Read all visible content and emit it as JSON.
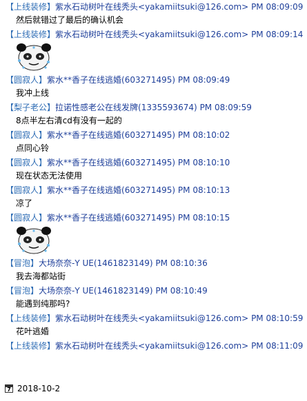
{
  "messages": [
    {
      "title": "【上线装修】",
      "sender": "紫水石动树叶在线秃头<yakamiitsuki@126.com>",
      "time": "PM 08:09:09"
    },
    {
      "text": "然后就错过了最后的确认机会"
    },
    {
      "title": "【上线装修】",
      "sender": "紫水石动树叶在线秃头<yakamiitsuki@126.com>",
      "time": "PM 08:09:14"
    },
    {
      "sticker": "panda-face-sticker"
    },
    {
      "title": "【圆寂人】",
      "sender": "紫水**香子在线逃婚(603271495)",
      "time": "PM 08:09:49"
    },
    {
      "text": "我冲上线"
    },
    {
      "title": "【梨子老公】",
      "sender": "拉诺性感老公在线发牌(1335593674)",
      "time": "PM 08:09:59"
    },
    {
      "text": "8点半左右清cd有没有一起的"
    },
    {
      "title": "【圆寂人】",
      "sender": "紫水**香子在线逃婚(603271495)",
      "time": "PM 08:10:02"
    },
    {
      "text": "点同心铃"
    },
    {
      "title": "【圆寂人】",
      "sender": "紫水**香子在线逃婚(603271495)",
      "time": "PM 08:10:10"
    },
    {
      "text": "现在状态无法使用"
    },
    {
      "title": "【圆寂人】",
      "sender": "紫水**香子在线逃婚(603271495)",
      "time": "PM 08:10:13"
    },
    {
      "text": "凉了"
    },
    {
      "title": "【圆寂人】",
      "sender": "紫水**香子在线逃婚(603271495)",
      "time": "PM 08:10:15"
    },
    {
      "sticker": "panda-face-sticker"
    },
    {
      "title": "【冒泡】",
      "sender": "大场奈奈-Y  UE(1461823149)",
      "time": "PM 08:10:36"
    },
    {
      "text": "我去海都站街"
    },
    {
      "title": "【冒泡】",
      "sender": "大场奈奈-Y  UE(1461823149)",
      "time": "PM 08:10:49"
    },
    {
      "text": "能遇到纯那吗?"
    },
    {
      "title": "【上线装修】",
      "sender": "紫水石动树叶在线秃头<yakamiitsuki@126.com>",
      "time": "PM 08:10:59"
    },
    {
      "text": "花叶逃婚"
    },
    {
      "title": "【上线装修】",
      "sender": "紫水石动树叶在线秃头<yakamiitsuki@126.com>",
      "time": "PM 08:11:09"
    }
  ],
  "footer": {
    "calendar_icon": "calendar-icon",
    "calendar_day": "7",
    "date": "2018-10-2"
  },
  "colors": {
    "header": "#1e3f9a",
    "text": "#000000"
  }
}
